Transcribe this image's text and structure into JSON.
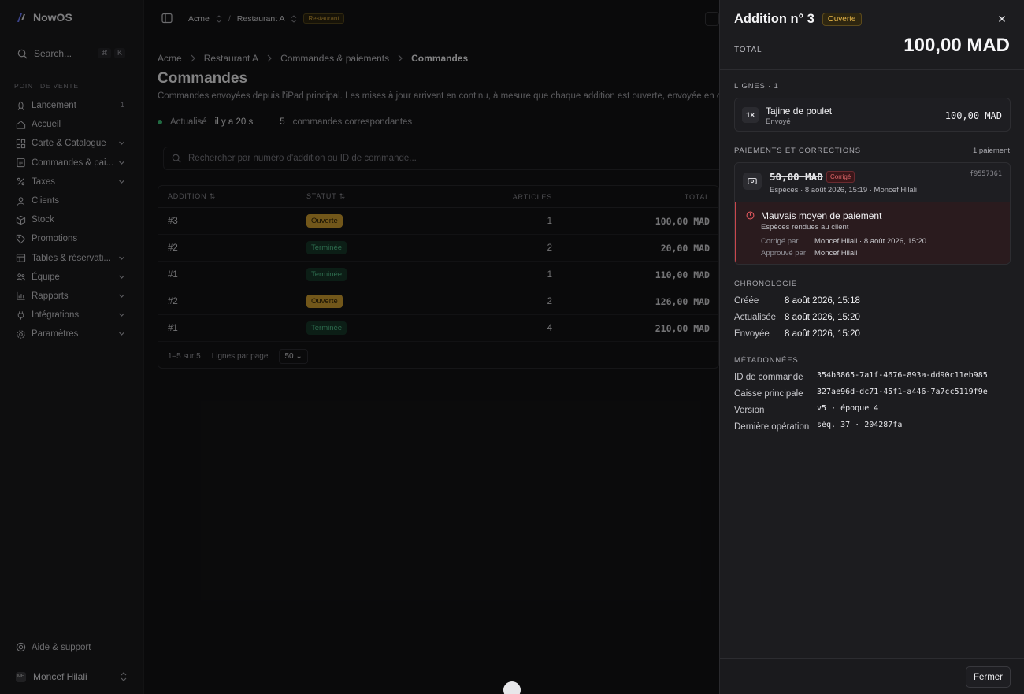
{
  "brand": {
    "name": "NowOS"
  },
  "sidebar": {
    "search_placeholder": "Search...",
    "search_kbd": [
      "⌘",
      "K"
    ],
    "section_label": "POINT DE VENTE",
    "items": [
      {
        "label": "Lancement",
        "icon": "rocket-icon",
        "count": "1"
      },
      {
        "label": "Accueil",
        "icon": "home-icon"
      },
      {
        "label": "Carte & Catalogue",
        "icon": "grid-icon",
        "expandable": true
      },
      {
        "label": "Commandes & pai...",
        "icon": "orders-icon",
        "expandable": true
      },
      {
        "label": "Taxes",
        "icon": "taxes-icon",
        "expandable": true
      },
      {
        "label": "Clients",
        "icon": "users-icon"
      },
      {
        "label": "Stock",
        "icon": "box-icon"
      },
      {
        "label": "Promotions",
        "icon": "tag-icon"
      },
      {
        "label": "Tables & réservati...",
        "icon": "table-icon",
        "expandable": true
      },
      {
        "label": "Équipe",
        "icon": "team-icon",
        "expandable": true
      },
      {
        "label": "Rapports",
        "icon": "chart-icon",
        "expandable": true
      },
      {
        "label": "Intégrations",
        "icon": "plug-icon",
        "expandable": true
      },
      {
        "label": "Paramètres",
        "icon": "gear-icon",
        "expandable": true
      }
    ],
    "help_label": "Aide & support",
    "user": {
      "initials": "MH",
      "name": "Moncef Hilali"
    }
  },
  "topbar": {
    "org": "Acme",
    "sep": "/",
    "venue": "Restaurant A",
    "venue_tag": "Restaurant"
  },
  "page": {
    "breadcrumb": [
      "Acme",
      "Restaurant A",
      "Commandes & paiements",
      "Commandes"
    ],
    "title": "Commandes",
    "description": "Commandes envoyées depuis l'iPad principal. Les mises à jour arrivent en continu, à mesure que chaque addition est ouverte, envoyée en cuisine ou réglée.",
    "status_prefix": "Actualisé",
    "status_time": "il y a 20 s",
    "status_count": "5",
    "status_count_label": "commandes correspondantes",
    "search_placeholder": "Rechercher par numéro d'addition ou ID de commande..."
  },
  "table": {
    "columns": [
      "ADDITION",
      "STATUT",
      "ARTICLES",
      "TOTAL"
    ],
    "rows": [
      {
        "addition": "#3",
        "status": "Ouverte",
        "status_kind": "open",
        "articles": "1",
        "total": "100,00 MAD"
      },
      {
        "addition": "#2",
        "status": "Terminée",
        "status_kind": "done",
        "articles": "2",
        "total": "20,00 MAD"
      },
      {
        "addition": "#1",
        "status": "Terminée",
        "status_kind": "done",
        "articles": "1",
        "total": "110,00 MAD"
      },
      {
        "addition": "#2",
        "status": "Ouverte",
        "status_kind": "open",
        "articles": "2",
        "total": "126,00 MAD"
      },
      {
        "addition": "#1",
        "status": "Terminée",
        "status_kind": "done",
        "articles": "4",
        "total": "210,00 MAD"
      }
    ],
    "footer_range": "1–5 sur 5",
    "rows_per_page_label": "Lignes par page",
    "rows_per_page": "50"
  },
  "drawer": {
    "title": "Addition n° 3",
    "status": "Ouverte",
    "total_label": "TOTAL",
    "total_value": "100,00 MAD",
    "lines_label": "LIGNES · 1",
    "line": {
      "qty": "1×",
      "name": "Tajine de poulet",
      "status": "Envoyé",
      "amount": "100,00 MAD"
    },
    "payments_label": "PAIEMENTS ET CORRECTIONS",
    "payments_count": "1 paiement",
    "payment": {
      "amount": "50,00 MAD",
      "badge": "Corrigé",
      "ref": "f9557361",
      "meta": "Espèces · 8 août 2026, 15:19 · Moncef Hilali"
    },
    "correction": {
      "title": "Mauvais moyen de paiement",
      "subtitle": "Espèces rendues au client",
      "corrected_label": "Corrigé par",
      "corrected_value": "Moncef Hilali · 8 août 2026, 15:20",
      "approved_label": "Approuvé par",
      "approved_value": "Moncef Hilali"
    },
    "chronology_label": "CHRONOLOGIE",
    "chronology": [
      {
        "label": "Créée",
        "value": "8 août 2026, 15:18"
      },
      {
        "label": "Actualisée",
        "value": "8 août 2026, 15:20"
      },
      {
        "label": "Envoyée",
        "value": "8 août 2026, 15:20"
      }
    ],
    "metadata_label": "MÉTADONNÉES",
    "metadata": [
      {
        "label": "ID de commande",
        "value": "354b3865-7a1f-4676-893a-dd90c11eb985"
      },
      {
        "label": "Caisse principale",
        "value": "327ae96d-dc71-45f1-a446-7a7cc5119f9e"
      },
      {
        "label": "Version",
        "value": "v5 · époque 4"
      },
      {
        "label": "Dernière opération",
        "value": "séq. 37 · 204287fa"
      }
    ],
    "close_button": "Fermer"
  },
  "colors": {
    "accent_open": "#d3a131",
    "done": "#52c48d",
    "error": "#c9474d",
    "background": "#141416"
  }
}
